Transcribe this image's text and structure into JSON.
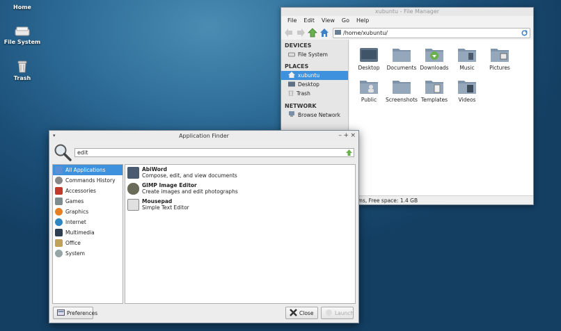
{
  "desktop": {
    "icons": [
      {
        "label": "Home",
        "icon": "home-folder-icon"
      },
      {
        "label": "File System",
        "icon": "drive-icon"
      },
      {
        "label": "Trash",
        "icon": "trash-icon"
      }
    ]
  },
  "file_manager": {
    "title": "xubuntu - File Manager",
    "menu": [
      "File",
      "Edit",
      "View",
      "Go",
      "Help"
    ],
    "path": "/home/xubuntu/",
    "sidebar": {
      "devices_heading": "DEVICES",
      "devices": [
        {
          "label": "File System"
        }
      ],
      "places_heading": "PLACES",
      "places": [
        {
          "label": "xubuntu",
          "selected": true
        },
        {
          "label": "Desktop"
        },
        {
          "label": "Trash"
        }
      ],
      "network_heading": "NETWORK",
      "network": [
        {
          "label": "Browse Network"
        }
      ]
    },
    "folders": [
      {
        "label": "Desktop",
        "icon": "desktop-folder-icon"
      },
      {
        "label": "Documents",
        "icon": "documents-folder-icon"
      },
      {
        "label": "Downloads",
        "icon": "downloads-folder-icon"
      },
      {
        "label": "Music",
        "icon": "music-folder-icon"
      },
      {
        "label": "Pictures",
        "icon": "pictures-folder-icon"
      },
      {
        "label": "Public",
        "icon": "public-folder-icon"
      },
      {
        "label": "Screenshots",
        "icon": "folder-icon"
      },
      {
        "label": "Templates",
        "icon": "templates-folder-icon"
      },
      {
        "label": "Videos",
        "icon": "videos-folder-icon"
      }
    ],
    "status": "items, Free space: 1.4 GB"
  },
  "app_finder": {
    "title": "Application Finder",
    "search_value": "edit",
    "categories": [
      {
        "label": "All Applications",
        "selected": true,
        "color": "#5b8fd6"
      },
      {
        "label": "Commands History",
        "color": "#888888"
      },
      {
        "label": "Accessories",
        "color": "#c0392b"
      },
      {
        "label": "Games",
        "color": "#7f8c8d"
      },
      {
        "label": "Graphics",
        "color": "#e67e22"
      },
      {
        "label": "Internet",
        "color": "#2e86c1"
      },
      {
        "label": "Multimedia",
        "color": "#2c3e50"
      },
      {
        "label": "Office",
        "color": "#bfa15a"
      },
      {
        "label": "System",
        "color": "#95a5a6"
      }
    ],
    "apps": [
      {
        "name": "AbiWord",
        "desc": "Compose, edit, and view documents",
        "color": "#4a5a70"
      },
      {
        "name": "GIMP Image Editor",
        "desc": "Create images and edit photographs",
        "color": "#6b6b5a"
      },
      {
        "name": "Mousepad",
        "desc": "Simple Text Editor",
        "color": "#e0e0e0"
      }
    ],
    "preferences_label": "Preferences",
    "close_label": "Close",
    "launch_label": "Launch"
  }
}
